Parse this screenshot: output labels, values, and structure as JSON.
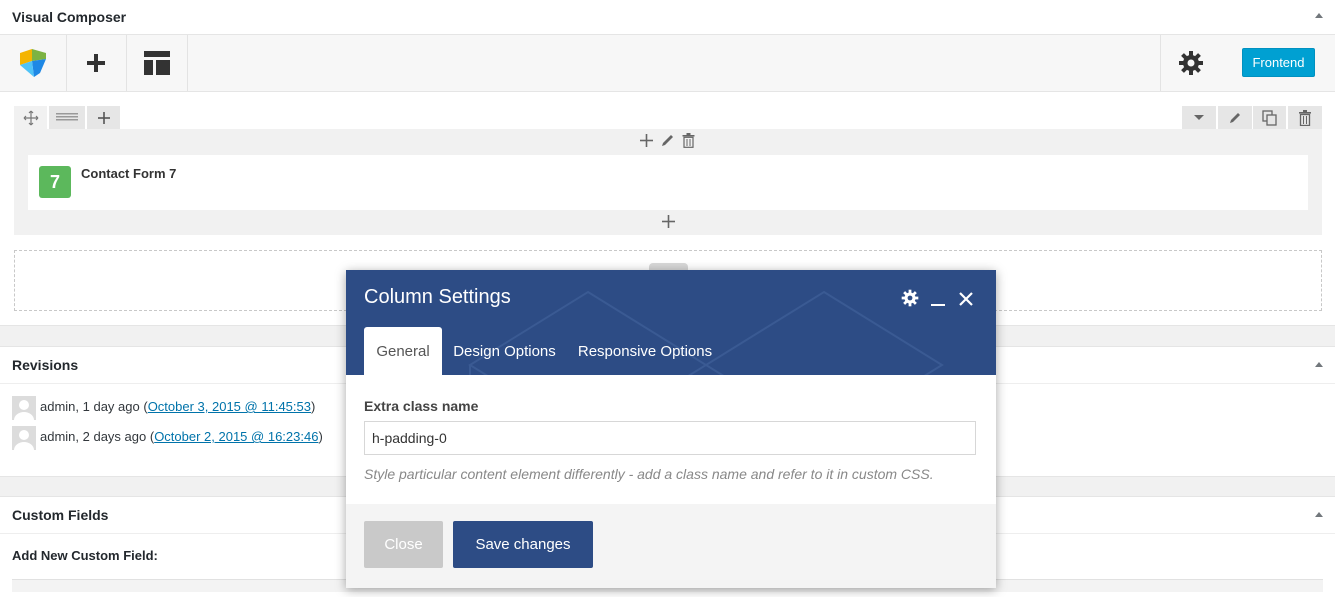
{
  "vc_panel": {
    "title": "Visual Composer",
    "toolbar": {
      "logo_icon": "vc-logo-icon",
      "add_icon": "plus-icon",
      "templates_icon": "templates-icon",
      "settings_icon": "gear-icon",
      "frontend_label": "Frontend"
    },
    "element": {
      "icon_label": "7",
      "name": "Contact Form 7"
    }
  },
  "revisions": {
    "title": "Revisions",
    "items": [
      {
        "author_text": "admin, 1 day ago (",
        "link": "October 3, 2015 @ 11:45:53",
        "suffix": ")"
      },
      {
        "author_text": "admin, 2 days ago (",
        "link": "October 2, 2015 @ 16:23:46",
        "suffix": ")"
      }
    ]
  },
  "custom_fields": {
    "title": "Custom Fields",
    "add_label": "Add New Custom Field:"
  },
  "modal": {
    "title": "Column Settings",
    "tabs": [
      "General",
      "Design Options",
      "Responsive Options"
    ],
    "active_tab": "General",
    "field_label": "Extra class name",
    "field_value": "h-padding-0",
    "help_text": "Style particular content element differently - add a class name and refer to it in custom CSS.",
    "close_label": "Close",
    "save_label": "Save changes"
  },
  "colors": {
    "modal_header": "#2d4c85",
    "frontend_button": "#00a0d2",
    "cf7_icon": "#5cb85c",
    "link": "#0073aa"
  }
}
